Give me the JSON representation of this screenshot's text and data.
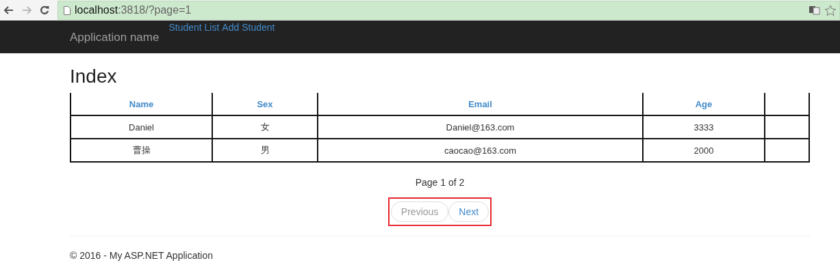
{
  "browser": {
    "url_host": "localhost",
    "url_rest": ":3818/?page=1"
  },
  "navbar": {
    "brand": "Application name",
    "links": [
      "Student List",
      "Add Student"
    ]
  },
  "heading": "Index",
  "table": {
    "columns": [
      "Name",
      "Sex",
      "Email",
      "Age",
      ""
    ],
    "rows": [
      [
        "Daniel",
        "女",
        "Daniel@163.com",
        "3333",
        ""
      ],
      [
        "曹操",
        "男",
        "caocao@163.com",
        "2000",
        ""
      ]
    ]
  },
  "pager": {
    "text": "Page 1 of 2",
    "buttons": [
      {
        "label": "Previous",
        "disabled": true
      },
      {
        "label": "Next",
        "disabled": false
      }
    ]
  },
  "footer": "© 2016 - My ASP.NET Application"
}
